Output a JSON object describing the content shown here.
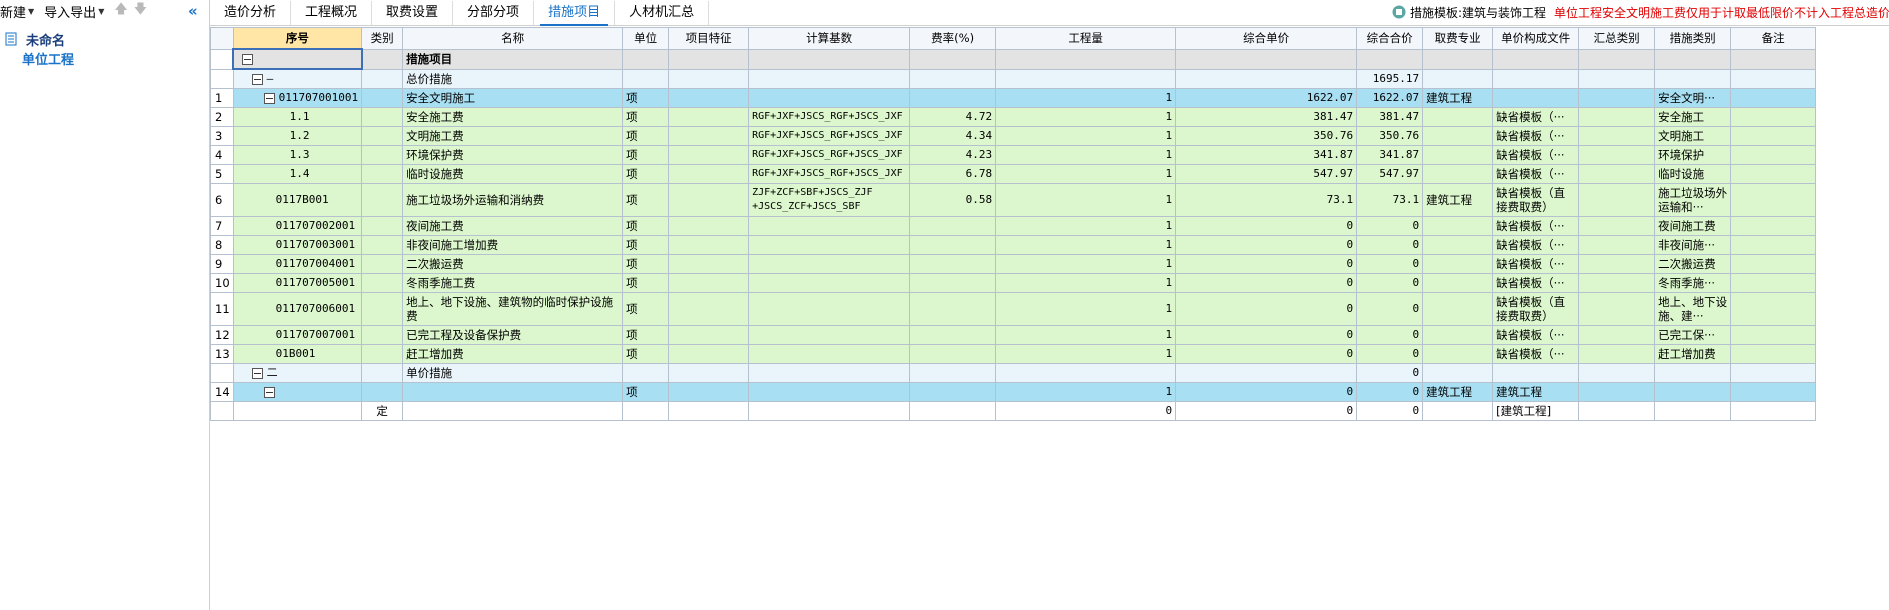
{
  "toolbar": {
    "new_label": "新建",
    "import_label": "导入导出"
  },
  "tree": {
    "root": "未命名",
    "child": "单位工程"
  },
  "tabs": [
    {
      "label": "造价分析"
    },
    {
      "label": "工程概况"
    },
    {
      "label": "取费设置"
    },
    {
      "label": "分部分项"
    },
    {
      "label": "措施项目"
    },
    {
      "label": "人材机汇总"
    }
  ],
  "active_tab": "措施项目",
  "template_label": "措施模板:建筑与装饰工程",
  "template_warning": "单位工程安全文明施工费仅用于计取最低限价不计入工程总造价",
  "columns": [
    "序号",
    "类别",
    "名称",
    "单位",
    "项目特征",
    "计算基数",
    "费率(%)",
    "工程量",
    "综合单价",
    "综合合价",
    "取费专业",
    "单价构成文件",
    "汇总类别",
    "措施类别",
    "备注"
  ],
  "rows": [
    {
      "idx": "",
      "seq": "",
      "cat": "",
      "name": "措施项目",
      "unit": "",
      "feat": "",
      "base": "",
      "rate": "",
      "qty": "",
      "price": "",
      "total": "",
      "spec": "",
      "file": "",
      "sum": "",
      "mtype": "",
      "note": ""
    },
    {
      "idx": "",
      "seq": "—",
      "cat": "",
      "name": "总价措施",
      "unit": "",
      "feat": "",
      "base": "",
      "rate": "",
      "qty": "",
      "price": "",
      "total": "1695.17",
      "spec": "",
      "file": "",
      "sum": "",
      "mtype": "",
      "note": ""
    },
    {
      "idx": "1",
      "seq": "011707001001",
      "cat": "",
      "name": "安全文明施工",
      "unit": "项",
      "feat": "",
      "base": "",
      "rate": "",
      "qty": "1",
      "price": "1622.07",
      "total": "1622.07",
      "spec": "建筑工程",
      "file": "",
      "sum": "",
      "mtype": "安全文明···",
      "note": ""
    },
    {
      "idx": "2",
      "seq": "1.1",
      "cat": "",
      "name": "安全施工费",
      "unit": "项",
      "feat": "",
      "base": "RGF+JXF+JSCS_RGF+JSCS_JXF",
      "rate": "4.72",
      "qty": "1",
      "price": "381.47",
      "total": "381.47",
      "spec": "",
      "file": "缺省模板（···",
      "sum": "",
      "mtype": "安全施工",
      "note": ""
    },
    {
      "idx": "3",
      "seq": "1.2",
      "cat": "",
      "name": "文明施工费",
      "unit": "项",
      "feat": "",
      "base": "RGF+JXF+JSCS_RGF+JSCS_JXF",
      "rate": "4.34",
      "qty": "1",
      "price": "350.76",
      "total": "350.76",
      "spec": "",
      "file": "缺省模板（···",
      "sum": "",
      "mtype": "文明施工",
      "note": ""
    },
    {
      "idx": "4",
      "seq": "1.3",
      "cat": "",
      "name": "环境保护费",
      "unit": "项",
      "feat": "",
      "base": "RGF+JXF+JSCS_RGF+JSCS_JXF",
      "rate": "4.23",
      "qty": "1",
      "price": "341.87",
      "total": "341.87",
      "spec": "",
      "file": "缺省模板（···",
      "sum": "",
      "mtype": "环境保护",
      "note": ""
    },
    {
      "idx": "5",
      "seq": "1.4",
      "cat": "",
      "name": "临时设施费",
      "unit": "项",
      "feat": "",
      "base": "RGF+JXF+JSCS_RGF+JSCS_JXF",
      "rate": "6.78",
      "qty": "1",
      "price": "547.97",
      "total": "547.97",
      "spec": "",
      "file": "缺省模板（···",
      "sum": "",
      "mtype": "临时设施",
      "note": ""
    },
    {
      "idx": "6",
      "seq": "0117B001",
      "cat": "",
      "name": "施工垃圾场外运输和消纳费",
      "unit": "项",
      "feat": "",
      "base": "ZJF+ZCF+SBF+JSCS_ZJF +JSCS_ZCF+JSCS_SBF",
      "rate": "0.58",
      "qty": "1",
      "price": "73.1",
      "total": "73.1",
      "spec": "建筑工程",
      "file": "缺省模板（直接费取费）",
      "sum": "",
      "mtype": "施工垃圾场外运输和···",
      "note": ""
    },
    {
      "idx": "7",
      "seq": "011707002001",
      "cat": "",
      "name": "夜间施工费",
      "unit": "项",
      "feat": "",
      "base": "",
      "rate": "",
      "qty": "1",
      "price": "0",
      "total": "0",
      "spec": "",
      "file": "缺省模板（···",
      "sum": "",
      "mtype": "夜间施工费",
      "note": ""
    },
    {
      "idx": "8",
      "seq": "011707003001",
      "cat": "",
      "name": "非夜间施工增加费",
      "unit": "项",
      "feat": "",
      "base": "",
      "rate": "",
      "qty": "1",
      "price": "0",
      "total": "0",
      "spec": "",
      "file": "缺省模板（···",
      "sum": "",
      "mtype": "非夜间施···",
      "note": ""
    },
    {
      "idx": "9",
      "seq": "011707004001",
      "cat": "",
      "name": "二次搬运费",
      "unit": "项",
      "feat": "",
      "base": "",
      "rate": "",
      "qty": "1",
      "price": "0",
      "total": "0",
      "spec": "",
      "file": "缺省模板（···",
      "sum": "",
      "mtype": "二次搬运费",
      "note": ""
    },
    {
      "idx": "10",
      "seq": "011707005001",
      "cat": "",
      "name": "冬雨季施工费",
      "unit": "项",
      "feat": "",
      "base": "",
      "rate": "",
      "qty": "1",
      "price": "0",
      "total": "0",
      "spec": "",
      "file": "缺省模板（···",
      "sum": "",
      "mtype": "冬雨季施···",
      "note": ""
    },
    {
      "idx": "11",
      "seq": "011707006001",
      "cat": "",
      "name": "地上、地下设施、建筑物的临时保护设施费",
      "unit": "项",
      "feat": "",
      "base": "",
      "rate": "",
      "qty": "1",
      "price": "0",
      "total": "0",
      "spec": "",
      "file": "缺省模板（直接费取费）",
      "sum": "",
      "mtype": "地上、地下设施、建···",
      "note": ""
    },
    {
      "idx": "12",
      "seq": "011707007001",
      "cat": "",
      "name": "已完工程及设备保护费",
      "unit": "项",
      "feat": "",
      "base": "",
      "rate": "",
      "qty": "1",
      "price": "0",
      "total": "0",
      "spec": "",
      "file": "缺省模板（···",
      "sum": "",
      "mtype": "已完工保···",
      "note": ""
    },
    {
      "idx": "13",
      "seq": "01B001",
      "cat": "",
      "name": "赶工增加费",
      "unit": "项",
      "feat": "",
      "base": "",
      "rate": "",
      "qty": "1",
      "price": "0",
      "total": "0",
      "spec": "",
      "file": "缺省模板（···",
      "sum": "",
      "mtype": "赶工增加费",
      "note": ""
    },
    {
      "idx": "",
      "seq": "二",
      "cat": "",
      "name": "单价措施",
      "unit": "",
      "feat": "",
      "base": "",
      "rate": "",
      "qty": "",
      "price": "",
      "total": "0",
      "spec": "",
      "file": "",
      "sum": "",
      "mtype": "",
      "note": ""
    },
    {
      "idx": "14",
      "seq": "",
      "cat": "",
      "name": "",
      "unit": "项",
      "feat": "",
      "base": "",
      "rate": "",
      "qty": "1",
      "price": "0",
      "total": "0",
      "spec": "建筑工程",
      "file": "建筑工程",
      "sum": "",
      "mtype": "",
      "note": ""
    },
    {
      "idx": "",
      "seq": "",
      "cat": "定",
      "name": "",
      "unit": "",
      "feat": "",
      "base": "",
      "rate": "",
      "qty": "0",
      "price": "0",
      "total": "0",
      "spec": "",
      "file": "[建筑工程]",
      "sum": "",
      "mtype": "",
      "note": ""
    }
  ],
  "icons": {
    "up": "arrow-up-icon",
    "down": "arrow-down-icon",
    "collapse": "double-chevron-left-icon",
    "project": "project-icon",
    "template": "template-icon"
  }
}
